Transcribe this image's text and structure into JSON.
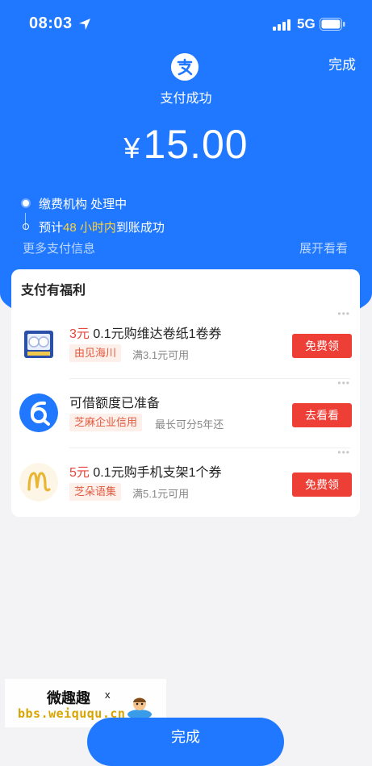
{
  "status_bar": {
    "time": "08:03",
    "network": "5G"
  },
  "header": {
    "done_label": "完成",
    "success_title": "支付成功",
    "currency": "¥",
    "amount": "15.00"
  },
  "timeline": {
    "step1": "缴费机构 处理中",
    "step2_prefix": "预计 ",
    "step2_highlight": "48 小时内",
    "step2_suffix": " 到账成功"
  },
  "more_info_label": "更多支付信息",
  "expand_label": "展开看看",
  "benefits": {
    "title": "支付有福利",
    "items": [
      {
        "amount": "3元",
        "title": " 0.1元购维达卷纸1卷券",
        "tag": "由见海川",
        "sub": "满3.1元可用",
        "button": "免费领"
      },
      {
        "amount": "",
        "title": "可借额度已准备",
        "tag": "芝麻企业信用",
        "sub": "最长可分5年还",
        "button": "去看看"
      },
      {
        "amount": "5元",
        "title": " 0.1元购手机支架1个券",
        "tag": "芝朵语集",
        "sub": "满5.1元可用",
        "button": "免费领"
      }
    ]
  },
  "watermark": {
    "title": "微趣趣",
    "mark": "x",
    "url": "bbs.weiququ.cn"
  },
  "bottom_button": "完成",
  "colors": {
    "primary_blue": "#1f78ff",
    "red_button": "#ee3f36",
    "highlight_yellow": "#ffd23a",
    "tag_text": "#e2583e"
  }
}
